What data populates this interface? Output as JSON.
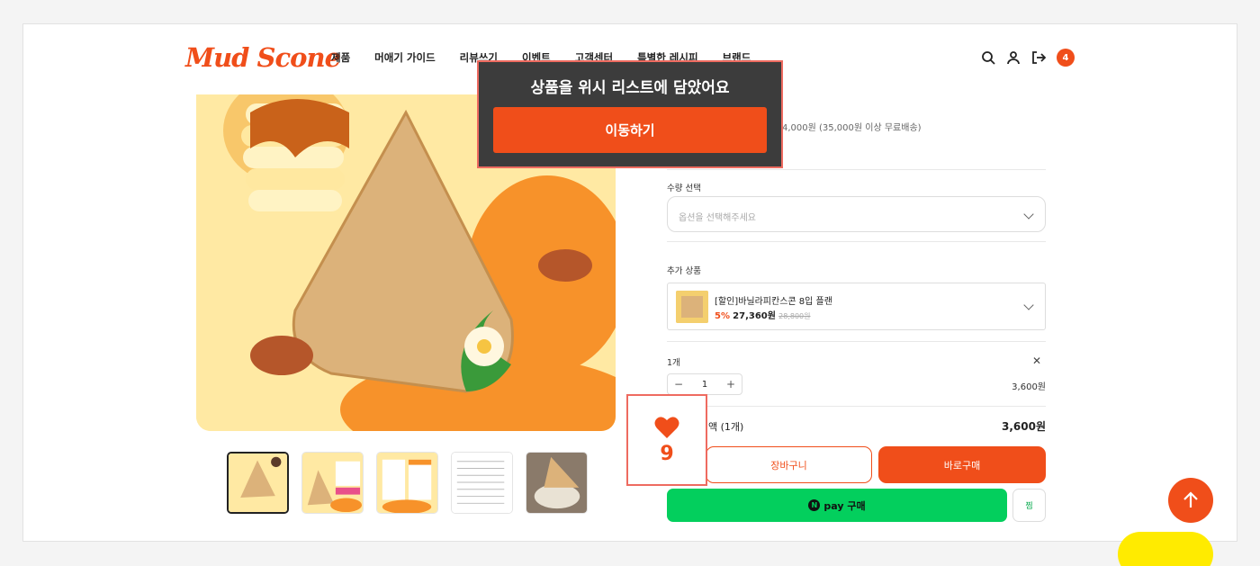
{
  "header": {
    "logo": "Mud Scone",
    "nav": [
      "제품",
      "머애기 가이드",
      "리뷰쓰기",
      "이벤트",
      "고객센터",
      "특별한 레시피",
      "브랜드"
    ],
    "cart_count": "4"
  },
  "product": {
    "shipping_text": "4,000원 (35,000원 이상 무료배송)",
    "quantity_label": "수량 선택",
    "select_placeholder": "옵션을 선택해주세요",
    "addon_label": "추가 상품",
    "addon": {
      "name": "[할인]바닐라피칸스콘 8입 플랜",
      "discount": "5%",
      "price": "27,360원",
      "original_price": "28,800원"
    },
    "line_item": {
      "label": "1개",
      "quantity": "1",
      "price": "3,600원"
    },
    "total_label": "액 (1개)",
    "total_price": "3,600원",
    "cart_button": "장바구니",
    "buy_button": "바로구매",
    "npay_button": "pay 구매",
    "npay_logo": "N",
    "zzim_button": "찜"
  },
  "wishlist": {
    "count": "9",
    "toast_message": "상품을 위시 리스트에 담았어요",
    "toast_button": "이동하기"
  },
  "colors": {
    "accent": "#f04e1a",
    "npay": "#03cf5d",
    "highlight_border": "#ee6b60"
  }
}
